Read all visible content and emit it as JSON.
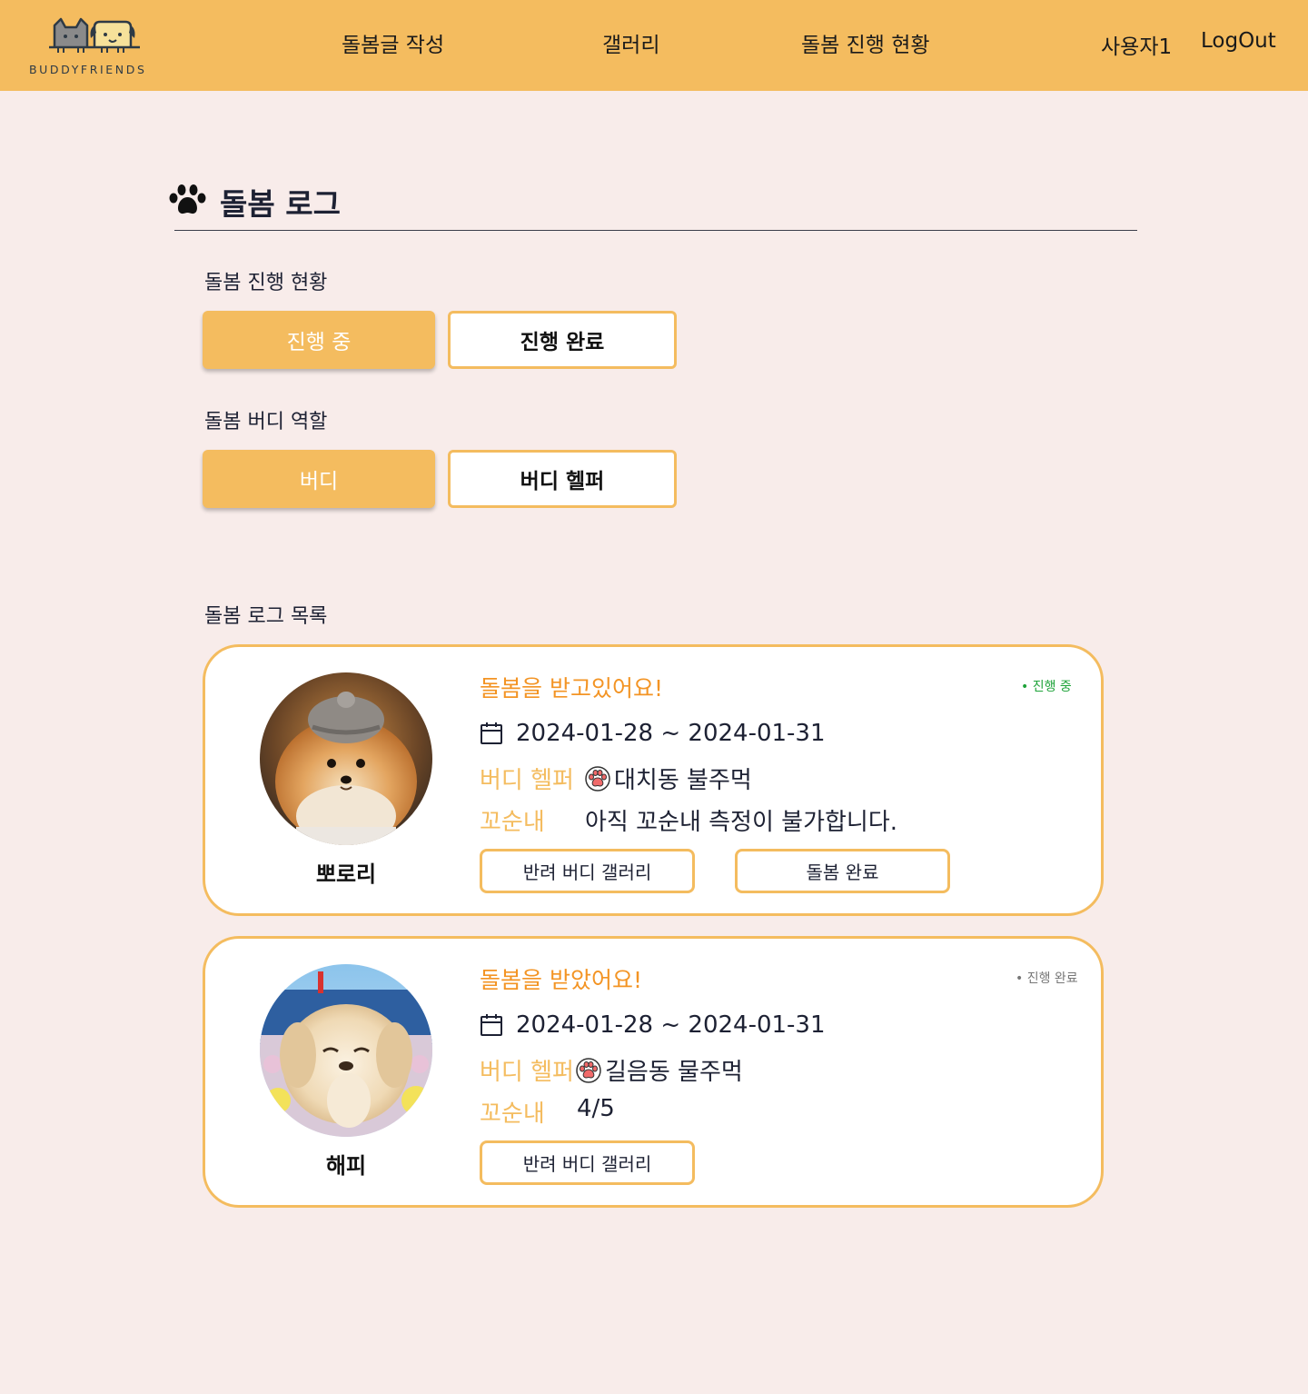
{
  "header": {
    "logo_text": "BUDDYFRIENDS",
    "nav": {
      "write": "돌봄글 작성",
      "gallery": "갤러리",
      "status": "돌봄 진행 현황"
    },
    "user": "사용자1",
    "logout": "LogOut"
  },
  "page": {
    "title": "돌봄 로그",
    "status_label": "돌봄 진행 현황",
    "status_options": [
      "진행 중",
      "진행 완료"
    ],
    "role_label": "돌봄 버디 역할",
    "role_options": [
      "버디",
      "버디 헬퍼"
    ],
    "list_label": "돌봄 로그 목록"
  },
  "logs": [
    {
      "heading": "돌봄을 받고있어요!",
      "status": "• 진행 중",
      "dates": "2024-01-28 ~ 2024-01-31",
      "helper_label": "버디 헬퍼",
      "helper_name": "대치동 불주먹",
      "smell_label": "꼬순내",
      "smell_value": "아직 꼬순내 측정이 불가합니다.",
      "pet_name": "뽀로리",
      "gallery_button": "반려 버디 갤러리",
      "complete_button": "돌봄 완료"
    },
    {
      "heading": "돌봄을 받았어요!",
      "status": "• 진행 완료",
      "dates": "2024-01-28 ~ 2024-01-31",
      "helper_label": "버디 헬퍼",
      "helper_name": "길음동 물주먹",
      "smell_label": "꼬순내",
      "smell_value": "4/5",
      "pet_name": "해피",
      "gallery_button": "반려 버디 갤러리"
    }
  ],
  "colors": {
    "header_bg": "#f4bc5f",
    "page_bg": "#f8ecea",
    "accent_orange": "#f39424",
    "status_active": "#1fa33a",
    "status_done": "#777777"
  },
  "icons": [
    "paw-icon",
    "calendar-icon",
    "paw-badge-icon"
  ]
}
